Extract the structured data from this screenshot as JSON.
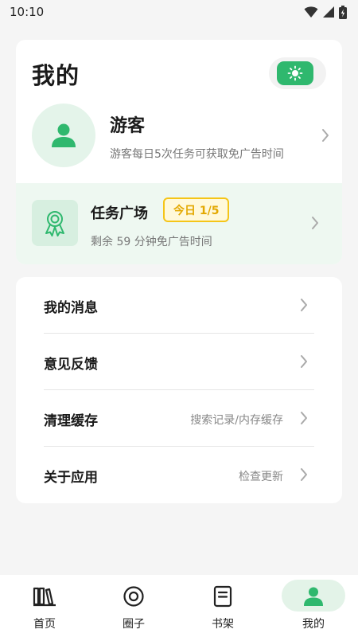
{
  "status_bar": {
    "time": "10:10"
  },
  "profile": {
    "title": "我的",
    "user_name": "游客",
    "user_desc": "游客每日5次任务可获取免广告时间",
    "task": {
      "title": "任务广场",
      "badge": "今日 1/5",
      "subtitle": "剩余 59 分钟免广告时间"
    }
  },
  "menu": [
    {
      "label": "我的消息",
      "value": ""
    },
    {
      "label": "意见反馈",
      "value": ""
    },
    {
      "label": "清理缓存",
      "value": "搜索记录/内存缓存"
    },
    {
      "label": "关于应用",
      "value": "检查更新"
    }
  ],
  "bottom_nav": [
    {
      "label": "首页",
      "icon": "bookshelf-books-icon",
      "active": false
    },
    {
      "label": "圈子",
      "icon": "circle-target-icon",
      "active": false
    },
    {
      "label": "书架",
      "icon": "book-page-icon",
      "active": false
    },
    {
      "label": "我的",
      "icon": "person-icon",
      "active": true
    }
  ],
  "colors": {
    "accent": "#2fb86e",
    "badge": "#f5c518",
    "background": "#f5f5f5"
  }
}
